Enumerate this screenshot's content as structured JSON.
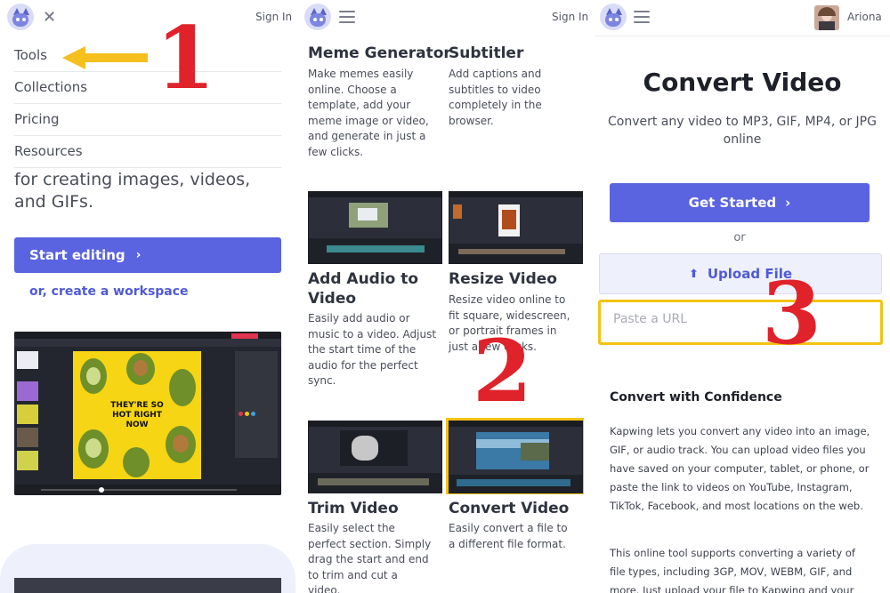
{
  "panel1": {
    "signin": "Sign In",
    "menu": [
      "Tools",
      "Collections",
      "Pricing",
      "Resources"
    ],
    "hero_text": "for creating images, videos, and GIFs.",
    "start_editing": "Start editing",
    "create_workspace": "or, create a workspace",
    "editor_overlay_text": "THEY'RE SO HOT RIGHT NOW",
    "step_number": "1"
  },
  "panel2": {
    "signin": "Sign In",
    "tools": [
      {
        "title": "Meme Generator",
        "desc": "Make memes easily online. Choose a template, add your meme image or video, and generate in just a few clicks."
      },
      {
        "title": "Subtitler",
        "desc": "Add captions and subtitles to video completely in the browser."
      },
      {
        "title": "Add Audio to Video",
        "desc": "Easily add audio or music to a video. Adjust the start time of the audio for the perfect sync."
      },
      {
        "title": "Resize Video",
        "desc": "Resize video online to fit square, widescreen, or portrait frames in just a few clicks."
      },
      {
        "title": "Trim Video",
        "desc": "Easily select the perfect section. Simply drag the start and end to trim and cut a video."
      },
      {
        "title": "Convert Video",
        "desc": "Easily convert a file to a different file format."
      }
    ],
    "step_number": "2"
  },
  "panel3": {
    "username": "Ariona",
    "title": "Convert Video",
    "subtitle": "Convert any video to MP3, GIF, MP4, or JPG online",
    "get_started": "Get Started",
    "or": "or",
    "upload_file": "Upload File",
    "url_placeholder": "Paste a URL",
    "section_heading": "Convert with Confidence",
    "paragraph1": "Kapwing lets you convert any video into an image, GIF, or audio track. You can upload video files you have saved on your computer, tablet, or phone, or paste the link to videos on YouTube, Instagram, TikTok, Facebook, and most locations on the web.",
    "paragraph2": "This online tool supports converting a variety of file types, including 3GP, MOV, WEBM, GIF, and more. Just upload your file to Kapwing and your",
    "step_number": "3"
  },
  "colors": {
    "accent": "#5a63e0",
    "highlight": "#f3c213",
    "annotation_red": "#e0222b",
    "arrow": "#f5bf1e"
  }
}
